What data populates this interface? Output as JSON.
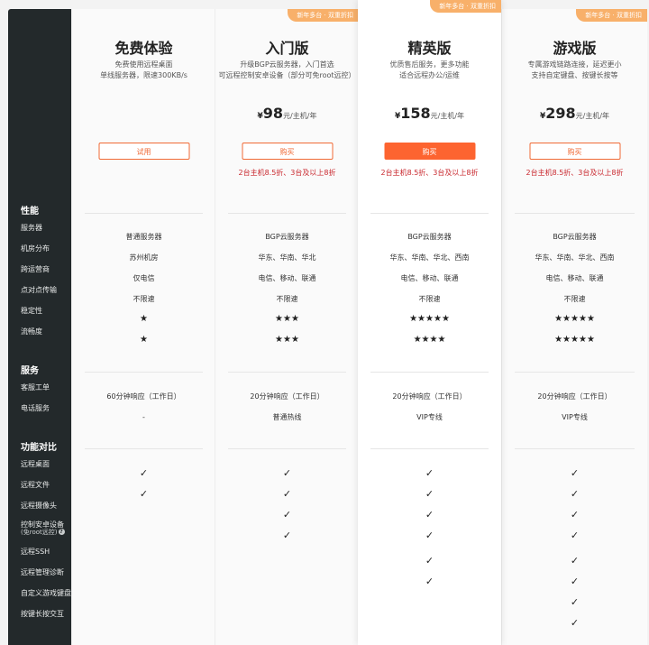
{
  "sidebar": {
    "sections": [
      {
        "label": "性能"
      },
      {
        "label": "服务"
      },
      {
        "label": "功能对比"
      }
    ],
    "rows": [
      "服务器",
      "机房分布",
      "跨运营商",
      "点对点传输",
      "稳定性",
      "流畅度",
      "客服工单",
      "电话服务",
      "远程桌面",
      "远程文件",
      "远程摄像头",
      "控制安卓设备",
      "远程SSH",
      "远程管理诊断",
      "自定义游戏键盘",
      "按键长按交互"
    ],
    "android_sub": "(免root远控)",
    "help_icon": "question-icon"
  },
  "badge_text": "新年多台 · 双重折扣",
  "plans": [
    {
      "title": "免费体验",
      "desc": [
        "免费使用远程桌面",
        "单线服务器，限速300KB/s"
      ],
      "price": null,
      "button": "试用",
      "discount": "",
      "badge": false,
      "perf": [
        "普通服务器",
        "苏州机房",
        "仅电信",
        "不限速",
        "★",
        "★"
      ],
      "service": [
        "60分钟响应（工作日）",
        "-"
      ],
      "features": [
        "✓",
        "✓",
        "",
        "",
        "",
        "",
        "",
        ""
      ]
    },
    {
      "title": "入门版",
      "desc": [
        "升级BGP云服务器，入门首选",
        "可远程控制安卓设备（部分可免root远控）"
      ],
      "price": {
        "cur": "¥",
        "num": "98",
        "unit": "元/主机/年"
      },
      "button": "购买",
      "discount": "2台主机8.5折、3台及以上8折",
      "badge": true,
      "perf": [
        "BGP云服务器",
        "华东、华南、华北",
        "电信、移动、联通",
        "不限速",
        "★★★",
        "★★★"
      ],
      "service": [
        "20分钟响应（工作日）",
        "普通热线"
      ],
      "features": [
        "✓",
        "✓",
        "✓",
        "✓",
        "",
        "",
        "",
        ""
      ]
    },
    {
      "title": "精英版",
      "desc": [
        "优质售后服务，更多功能",
        "适合远程办公/运维"
      ],
      "price": {
        "cur": "¥",
        "num": "158",
        "unit": "元/主机/年"
      },
      "button": "购买",
      "discount": "2台主机8.5折、3台及以上8折",
      "badge": true,
      "perf": [
        "BGP云服务器",
        "华东、华南、华北、西南",
        "电信、移动、联通",
        "不限速",
        "★★★★★",
        "★★★★"
      ],
      "service": [
        "20分钟响应（工作日）",
        "VIP专线"
      ],
      "features": [
        "✓",
        "✓",
        "✓",
        "✓",
        "✓",
        "✓",
        "",
        ""
      ]
    },
    {
      "title": "游戏版",
      "desc": [
        "专属游戏链路连接，延迟更小",
        "支持自定键盘、按键长按等"
      ],
      "price": {
        "cur": "¥",
        "num": "298",
        "unit": "元/主机/年"
      },
      "button": "购买",
      "discount": "2台主机8.5折、3台及以上8折",
      "badge": true,
      "perf": [
        "BGP云服务器",
        "华东、华南、华北、西南",
        "电信、移动、联通",
        "不限速",
        "★★★★★",
        "★★★★★"
      ],
      "service": [
        "20分钟响应（工作日）",
        "VIP专线"
      ],
      "features": [
        "✓",
        "✓",
        "✓",
        "✓",
        "✓",
        "✓",
        "✓",
        "✓"
      ]
    }
  ],
  "colors": {
    "sidebar": "#23292b",
    "accent": "#fd6430",
    "discount": "#c9282e",
    "badge": "#f8b06a"
  }
}
